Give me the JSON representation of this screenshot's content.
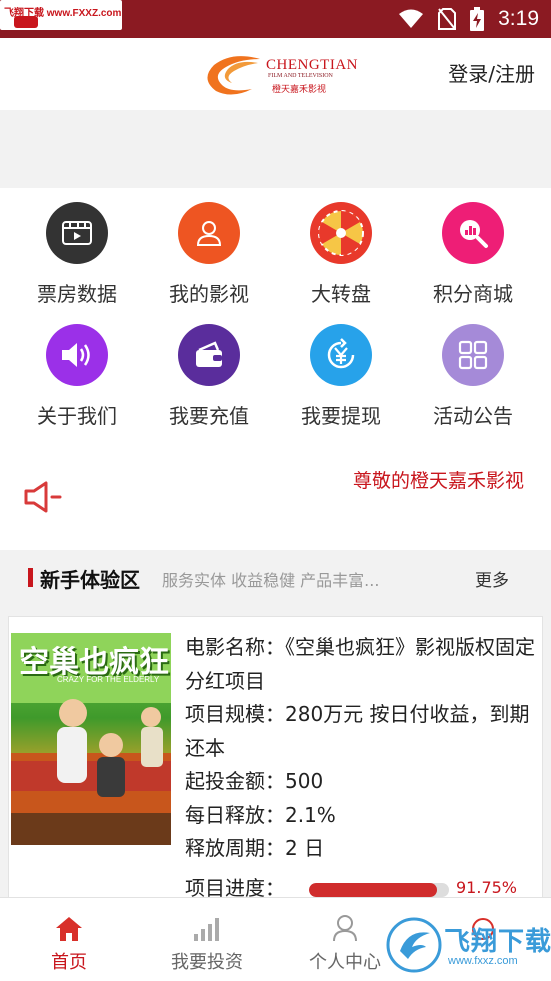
{
  "status_bar": {
    "watermark": "飞翔下载 www.FXXZ.com",
    "time": "3:19"
  },
  "header": {
    "logo_en": "CHENGTIAN",
    "logo_sub": "FILM AND TELEVISION",
    "logo_cn": "橙天嘉禾影视",
    "login_label": "登录/注册"
  },
  "grid": {
    "items": [
      {
        "label": "票房数据",
        "icon": "film-icon",
        "color": "#333333"
      },
      {
        "label": "我的影视",
        "icon": "user-icon",
        "color": "#ee5522"
      },
      {
        "label": "大转盘",
        "icon": "wheel-icon",
        "color": "#e8392b"
      },
      {
        "label": "积分商城",
        "icon": "search-chart-icon",
        "color": "#ee1e76"
      },
      {
        "label": "关于我们",
        "icon": "speaker-icon",
        "color": "#9b30e8"
      },
      {
        "label": "我要充值",
        "icon": "wallet-icon",
        "color": "#5a2d9c"
      },
      {
        "label": "我要提现",
        "icon": "yen-icon",
        "color": "#27a2ea"
      },
      {
        "label": "活动公告",
        "icon": "grid-icon",
        "color": "#a58ad8"
      }
    ]
  },
  "notice": {
    "text": "尊敬的橙天嘉禾影视"
  },
  "section": {
    "title": "新手体验区",
    "subtitle": "服务实体 收益稳健 产品丰富...",
    "more": "更多"
  },
  "card": {
    "poster_title": "空巢也疯狂",
    "poster_en": "CRAZY FOR THE ELDERLY",
    "line1": "电影名称：《空巢也疯狂》影视版权固定分红项目",
    "line2": "项目规模：280万元 按日付收益，到期还本",
    "line3": "起投金额：500",
    "line4": "每日释放：2.1%",
    "line5": "释放周期：2 日",
    "progress_label": "项目进度：",
    "progress_value": 0.9175,
    "progress_text": "91.75%"
  },
  "bottom_nav": {
    "items": [
      {
        "label": "首页",
        "icon": "home-icon",
        "active": true
      },
      {
        "label": "我要投资",
        "icon": "bar-chart-icon",
        "active": false
      },
      {
        "label": "个人中心",
        "icon": "person-icon",
        "active": false
      },
      {
        "label": "",
        "icon": "more-icon",
        "active": false
      }
    ]
  },
  "watermark_bottom": {
    "name": "飞翔下载",
    "url": "www.fxxz.com"
  },
  "colors": {
    "brand_red": "#c8161d",
    "status_bar": "#8b1a22",
    "progress": "#d02c2c"
  }
}
